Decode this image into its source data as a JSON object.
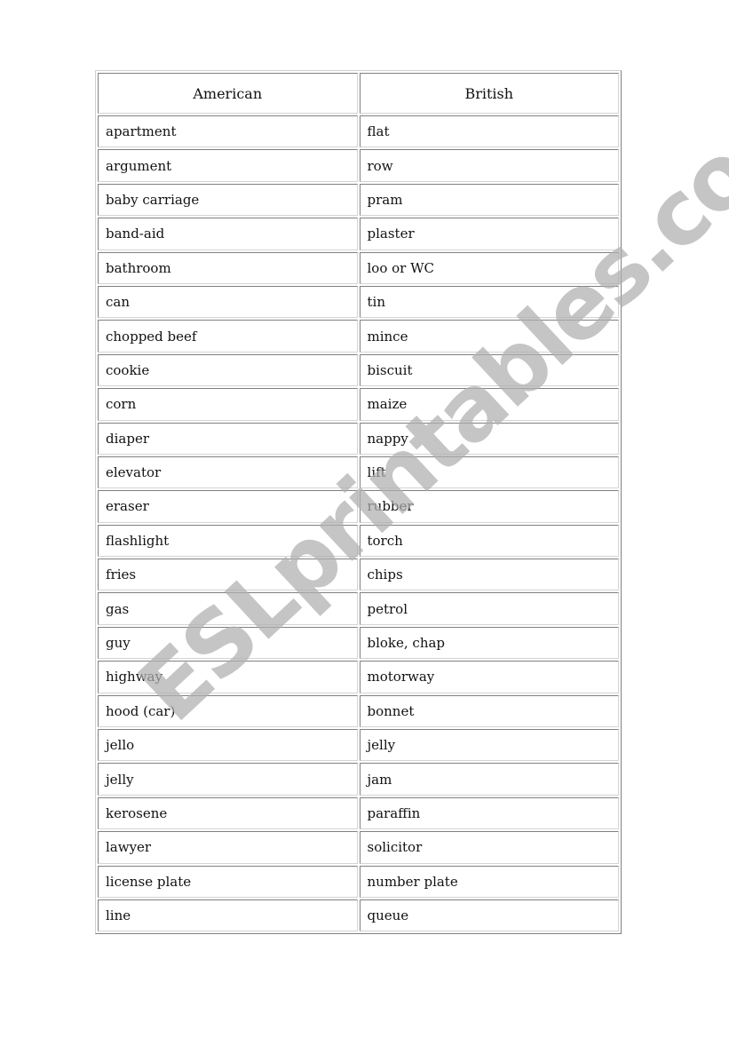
{
  "headers": {
    "american": "American",
    "british": "British"
  },
  "rows": [
    [
      "apartment",
      "flat"
    ],
    [
      "argument",
      "row"
    ],
    [
      "baby carriage",
      "pram"
    ],
    [
      "band-aid",
      "plaster"
    ],
    [
      "bathroom",
      "loo or WC"
    ],
    [
      "can",
      "tin"
    ],
    [
      "chopped beef",
      "mince"
    ],
    [
      "cookie",
      "biscuit"
    ],
    [
      "corn",
      "maize"
    ],
    [
      "diaper",
      "nappy"
    ],
    [
      "elevator",
      "lift"
    ],
    [
      "eraser",
      "rubber"
    ],
    [
      "flashlight",
      "torch"
    ],
    [
      "fries",
      "chips"
    ],
    [
      "gas",
      "petrol"
    ],
    [
      "guy",
      "bloke, chap"
    ],
    [
      "highway",
      "motorway"
    ],
    [
      "hood (car)",
      "bonnet"
    ],
    [
      "jello",
      "jelly"
    ],
    [
      "jelly",
      "jam"
    ],
    [
      "kerosene",
      "paraffin"
    ],
    [
      "lawyer",
      "solicitor"
    ],
    [
      "license plate",
      "number plate"
    ],
    [
      "line",
      "queue"
    ]
  ],
  "watermark": "ESLprintables.com"
}
